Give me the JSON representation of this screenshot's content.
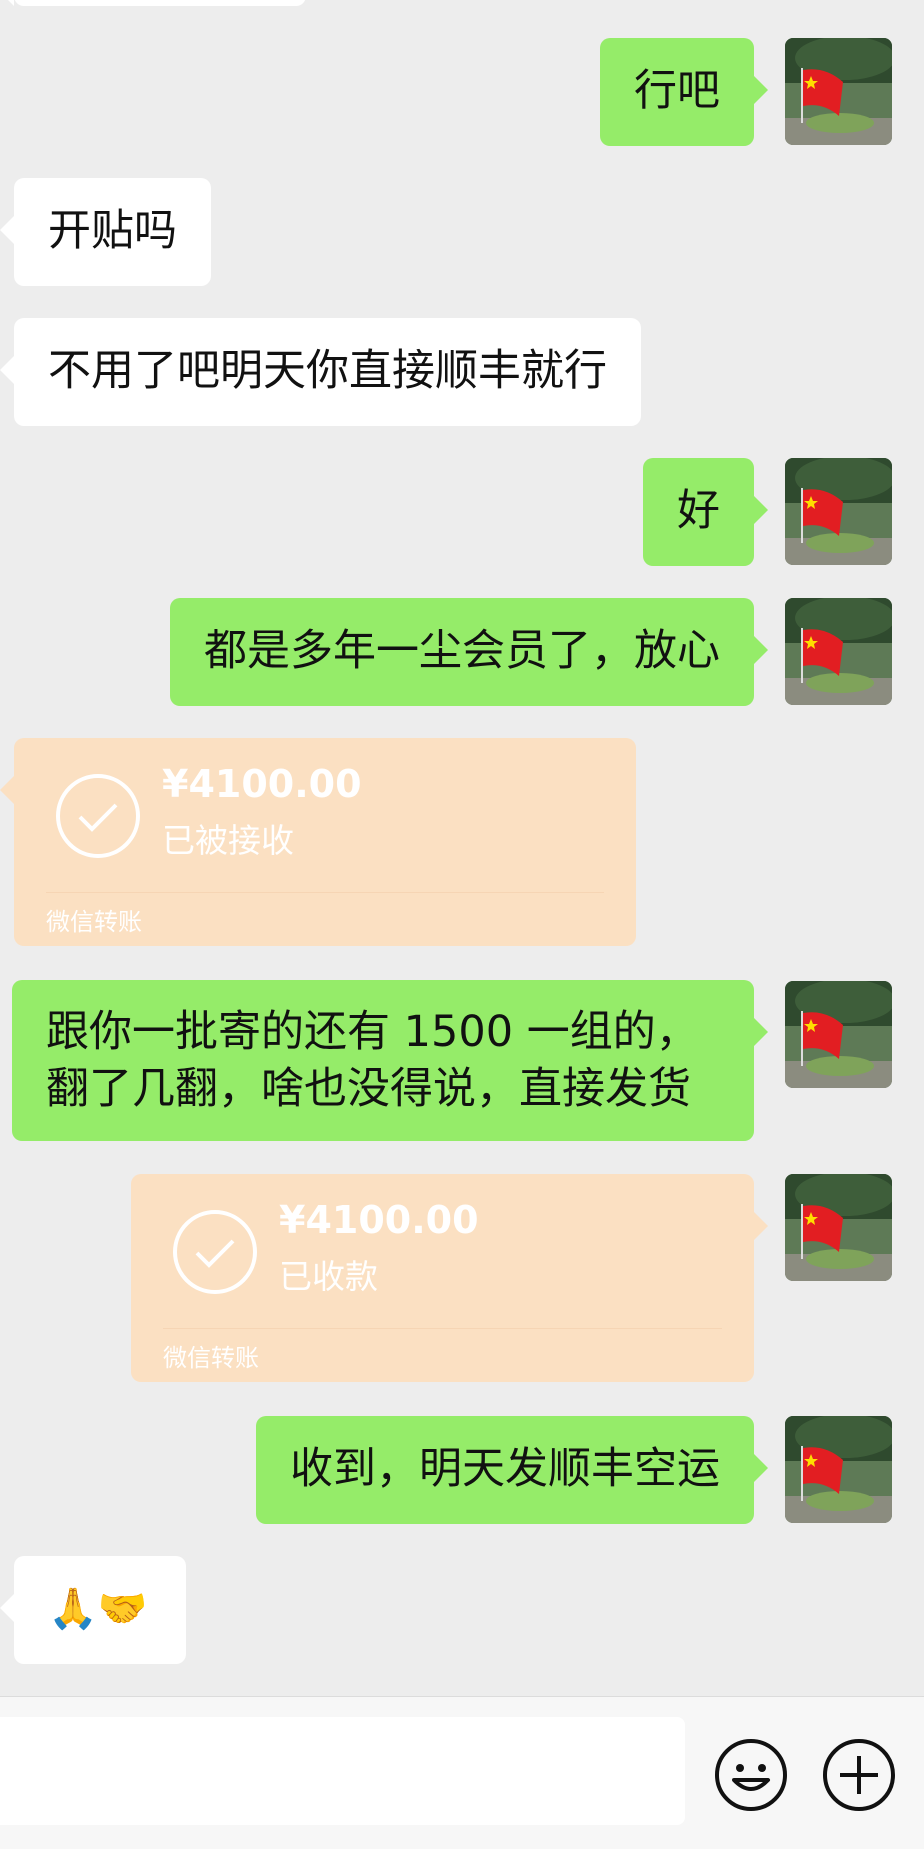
{
  "messages": {
    "m1": "行吧",
    "m2": "开贴吗",
    "m3": "不用了吧明天你直接顺丰就行",
    "m4": "好",
    "m5": "都是多年一尘会员了，放心",
    "m6_line1": "跟你一批寄的还有 1500 一组的，",
    "m6_line2": "翻了几翻，啥也没得说，直接发货",
    "m7": "收到，明天发顺丰空运",
    "m8": "🙏🤝"
  },
  "transfers": [
    {
      "amount": "¥4100.00",
      "status": "已被接收",
      "label": "微信转账"
    },
    {
      "amount": "¥4100.00",
      "status": "已收款",
      "label": "微信转账"
    }
  ],
  "colors": {
    "background": "#ededed",
    "incoming_bubble": "#ffffff",
    "outgoing_bubble": "#95ec69",
    "transfer_card": "#fbe0c2"
  },
  "icons": {
    "transfer": "check-circle-icon",
    "emoji": "emoji-face-icon",
    "add": "plus-circle-icon"
  }
}
